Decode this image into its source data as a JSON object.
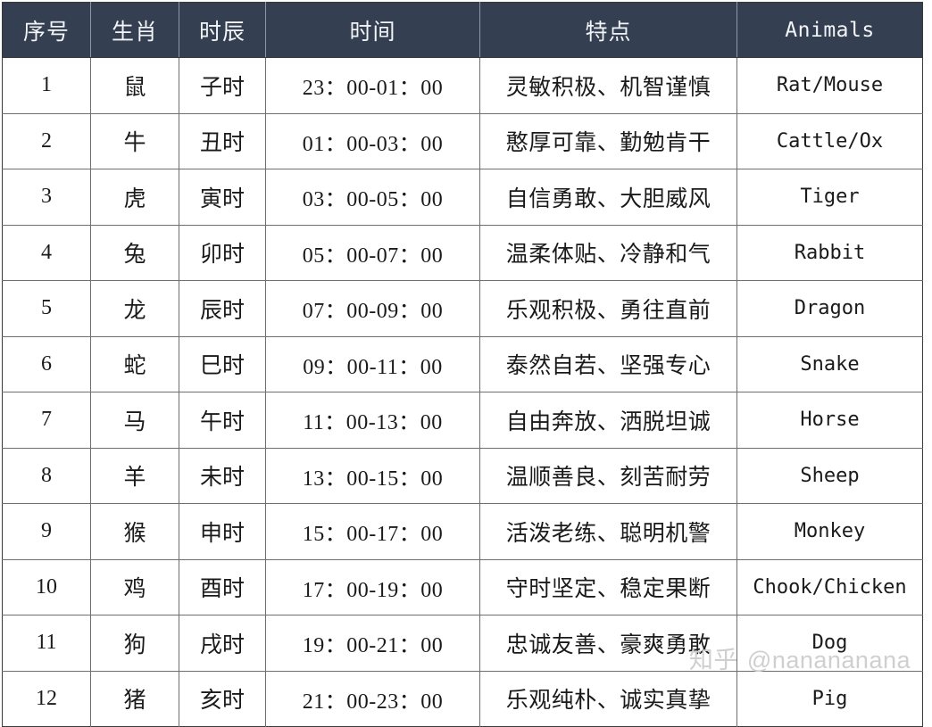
{
  "table": {
    "headers": [
      {
        "label": "序号",
        "name": "index"
      },
      {
        "label": "生肖",
        "name": "zodiac"
      },
      {
        "label": "时辰",
        "name": "shichen"
      },
      {
        "label": "时间",
        "name": "time"
      },
      {
        "label": "特点",
        "name": "traits"
      },
      {
        "label": "Animals",
        "name": "animals"
      }
    ],
    "header_bg": "#343f51",
    "header_text_color": "#f2f4f7",
    "grid_color": "#6e6e6e",
    "rows": [
      {
        "index": "1",
        "zodiac": "鼠",
        "shichen": "子时",
        "time": "23：00-01：00",
        "traits": "灵敏积极、机智谨慎",
        "animal": "Rat/Mouse"
      },
      {
        "index": "2",
        "zodiac": "牛",
        "shichen": "丑时",
        "time": "01：00-03：00",
        "traits": "憨厚可靠、勤勉肯干",
        "animal": "Cattle/Ox"
      },
      {
        "index": "3",
        "zodiac": "虎",
        "shichen": "寅时",
        "time": "03：00-05：00",
        "traits": "自信勇敢、大胆威风",
        "animal": "Tiger"
      },
      {
        "index": "4",
        "zodiac": "兔",
        "shichen": "卯时",
        "time": "05：00-07：00",
        "traits": "温柔体贴、冷静和气",
        "animal": "Rabbit"
      },
      {
        "index": "5",
        "zodiac": "龙",
        "shichen": "辰时",
        "time": "07：00-09：00",
        "traits": "乐观积极、勇往直前",
        "animal": "Dragon"
      },
      {
        "index": "6",
        "zodiac": "蛇",
        "shichen": "巳时",
        "time": "09：00-11：00",
        "traits": "泰然自若、坚强专心",
        "animal": "Snake"
      },
      {
        "index": "7",
        "zodiac": "马",
        "shichen": "午时",
        "time": "11：00-13：00",
        "traits": "自由奔放、洒脱坦诚",
        "animal": "Horse"
      },
      {
        "index": "8",
        "zodiac": "羊",
        "shichen": "未时",
        "time": "13：00-15：00",
        "traits": "温顺善良、刻苦耐劳",
        "animal": "Sheep"
      },
      {
        "index": "9",
        "zodiac": "猴",
        "shichen": "申时",
        "time": "15：00-17：00",
        "traits": "活泼老练、聪明机警",
        "animal": "Monkey"
      },
      {
        "index": "10",
        "zodiac": "鸡",
        "shichen": "酉时",
        "time": "17：00-19：00",
        "traits": "守时坚定、稳定果断",
        "animal": "Chook/Chicken"
      },
      {
        "index": "11",
        "zodiac": "狗",
        "shichen": "戌时",
        "time": "19：00-21：00",
        "traits": "忠诚友善、豪爽勇敢",
        "animal": "Dog"
      },
      {
        "index": "12",
        "zodiac": "猪",
        "shichen": "亥时",
        "time": "21：00-23：00",
        "traits": "乐观纯朴、诚实真挚",
        "animal": "Pig"
      }
    ]
  },
  "watermark": {
    "logo": "知乎",
    "handle": "@nanananana",
    "color": "#cfcfcf"
  }
}
